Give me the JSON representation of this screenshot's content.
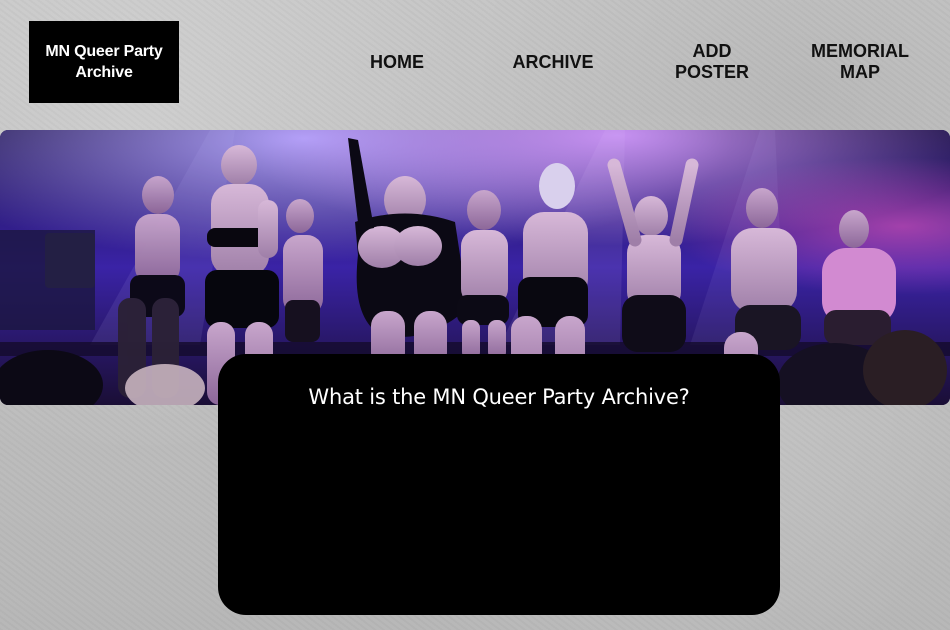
{
  "site": {
    "logo": "MN Queer Party Archive"
  },
  "nav": {
    "items": [
      {
        "key": "home",
        "label": "HOME"
      },
      {
        "key": "archive",
        "label": "ARCHIVE"
      },
      {
        "key": "add_poster",
        "label": "ADD POSTER"
      },
      {
        "key": "memorial_map",
        "label": "MEMORIAL MAP"
      }
    ]
  },
  "hero": {
    "image": "performers on stage under purple stage lights"
  },
  "info_card": {
    "title": "What is the MN Queer Party Archive?"
  },
  "colors": {
    "background": "#bdbdbd",
    "logo_background": "#000000",
    "logo_text": "#ffffff",
    "card_background": "#000000",
    "card_text": "#ffffff",
    "hero_purple": "#3d24b0"
  }
}
